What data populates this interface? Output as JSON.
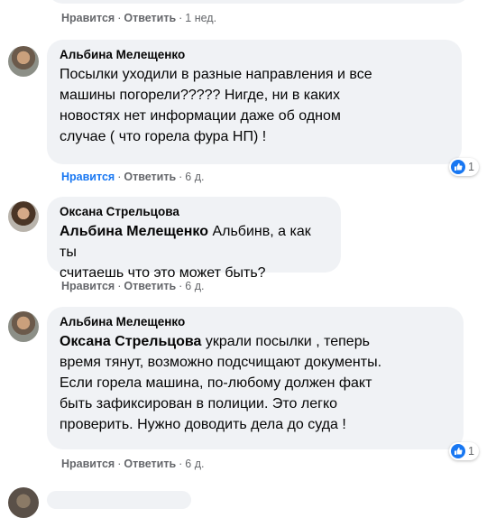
{
  "top_comment": {
    "like_label": "Нравится",
    "reply_label": "Ответить",
    "time": "1 нед."
  },
  "comments": [
    {
      "author": "Альбина Мелещенко",
      "mention": "",
      "text": "Посылки уходили в разные направления и все машины погорели????? Нигде, ни в каких новостях нет информации даже об одном случае ( что горела фура НП) !",
      "lines": [
        "Посылки уходили в разные направления и все",
        "машины погорели????? Нигде, ни в каких",
        "новостях нет информации даже об одном",
        "случае ( что горела фура НП) !"
      ],
      "like_label": "Нравится",
      "reply_label": "Ответить",
      "time": "6 д.",
      "reaction": "like",
      "reaction_count": "1"
    },
    {
      "author": "Оксана Стрельцова",
      "mention": "Альбина Мелещенко",
      "lines": [
        "Альбинв, а как ты",
        "считаешь что это может быть?"
      ],
      "like_label": "Нравится",
      "reply_label": "Ответить",
      "time": "6 д."
    },
    {
      "author": "Альбина Мелещенко",
      "mention": "Оксана Стрельцова",
      "lines": [
        "украли посылки , теперь",
        "время тянут, возможно подсчищают документы.",
        "Если горела машина, по-любому должен факт",
        "быть зафиксирован в полиции. Это легко",
        "проверить. Нужно доводить дела до суда !"
      ],
      "like_label": "Нравится",
      "reply_label": "Ответить",
      "time": "6 д.",
      "reaction": "like",
      "reaction_count": "1"
    }
  ],
  "colors": {
    "bubble": "#f0f2f5",
    "meta_text": "#65676b",
    "like_active": "#1877f2"
  }
}
